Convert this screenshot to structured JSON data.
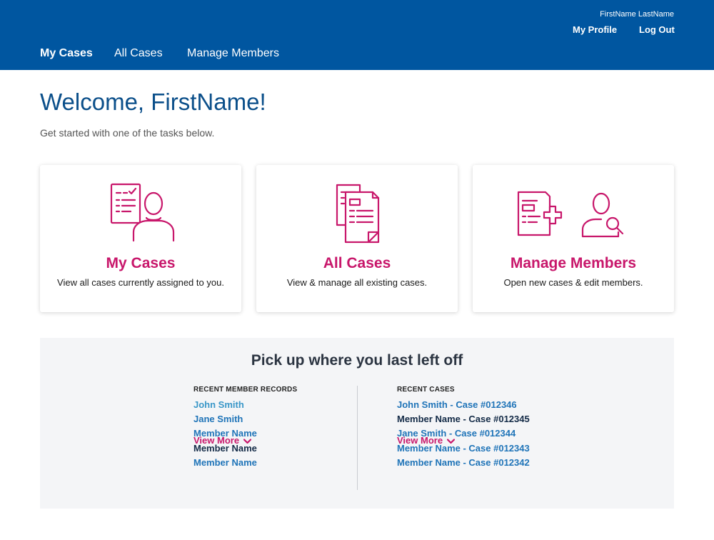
{
  "header": {
    "user_name": "FirstName LastName",
    "my_profile": "My Profile",
    "log_out": "Log Out",
    "nav": [
      {
        "label": "My Cases"
      },
      {
        "label": "All Cases"
      },
      {
        "label": "Manage Members"
      }
    ]
  },
  "main": {
    "welcome": "Welcome, FirstName!",
    "subtitle": "Get started with one of the tasks below."
  },
  "cards": [
    {
      "title": "My Cases",
      "description": "View all cases currently assigned to you.",
      "icon": "assigned-case-user-icon"
    },
    {
      "title": "All Cases",
      "description": "View & manage all existing cases.",
      "icon": "stacked-documents-icon"
    },
    {
      "title": "Manage Members",
      "description": "Open new cases & edit members.",
      "icon": "document-plus-member-search-icon"
    }
  ],
  "recent": {
    "title": "Pick up where you last left off",
    "members_heading": "RECENT MEMBER RECORDS",
    "members": [
      "John Smith",
      "Jane Smith",
      "Member Name",
      "Member Name",
      "Member Name"
    ],
    "cases_heading": "RECENT CASES",
    "cases": [
      "John Smith - Case #012346",
      "Member Name - Case #012345",
      "Jane Smith - Case #012344",
      "Member Name - Case #012343",
      "Member Name - Case #012342"
    ],
    "view_more": "View More"
  },
  "colors": {
    "header_bg": "#0056a0",
    "accent": "#c8176b",
    "link": "#1f74b8",
    "title": "#0b4f8a"
  }
}
